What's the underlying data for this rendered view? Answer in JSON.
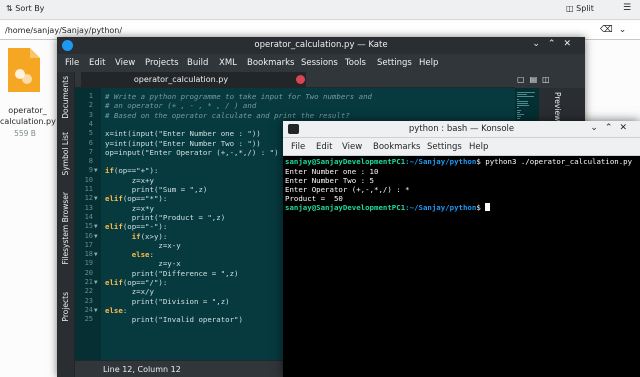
{
  "dolphin": {
    "sort_label": "Sort By",
    "split_label": "Split",
    "location": "/home/sanjay/Sanjay/python/",
    "file": {
      "name_line1": "operator_",
      "name_line2": "calculation.py",
      "size": "559 B",
      "icon": "python-file-icon"
    }
  },
  "kate": {
    "title": "operator_calculation.py — Kate",
    "menu": [
      "File",
      "Edit",
      "View",
      "Projects",
      "Build",
      "XML",
      "Bookmarks",
      "Sessions",
      "Tools",
      "Settings",
      "Help"
    ],
    "sidebar_tabs": [
      "Documents",
      "Symbol List",
      "Filesystem Browser",
      "Projects"
    ],
    "tab_label": "operator_calculation.py",
    "preview_label": "Preview",
    "status": "Line 12, Column 12",
    "code_lines": [
      {
        "n": "1",
        "parts": [
          [
            "c-comment",
            "# Write a python programme to take input for Two numbers and"
          ]
        ]
      },
      {
        "n": "2",
        "parts": [
          [
            "c-comment",
            "# an operator (+ , - , * , / ) and"
          ]
        ]
      },
      {
        "n": "3",
        "parts": [
          [
            "c-comment",
            "# Based on the operator calculate and print the result?"
          ]
        ]
      },
      {
        "n": "4",
        "parts": [
          [
            "c-plain",
            ""
          ]
        ]
      },
      {
        "n": "5",
        "parts": [
          [
            "c-plain",
            "x=int(input(\"Enter Number one : \"))"
          ]
        ]
      },
      {
        "n": "6",
        "parts": [
          [
            "c-plain",
            "y=int(input(\"Enter Number Two : \"))"
          ]
        ]
      },
      {
        "n": "7",
        "parts": [
          [
            "c-plain",
            "op=input(\"Enter Operator (+,-,*,/) : \")"
          ]
        ]
      },
      {
        "n": "8",
        "parts": [
          [
            "c-plain",
            ""
          ]
        ]
      },
      {
        "n": "9",
        "parts": [
          [
            "c-key",
            "if"
          ],
          [
            "c-plain",
            "(op==\"+\"):"
          ]
        ]
      },
      {
        "n": "10",
        "parts": [
          [
            "c-plain",
            "      z=x+y"
          ]
        ]
      },
      {
        "n": "11",
        "parts": [
          [
            "c-plain",
            "      print(\"Sum = \",z)"
          ]
        ]
      },
      {
        "n": "12",
        "parts": [
          [
            "c-key",
            "elif"
          ],
          [
            "c-plain",
            "(op==\"*\"):"
          ]
        ]
      },
      {
        "n": "13",
        "parts": [
          [
            "c-plain",
            "      z=x*y"
          ]
        ]
      },
      {
        "n": "14",
        "parts": [
          [
            "c-plain",
            "      print(\"Product = \",z)"
          ]
        ]
      },
      {
        "n": "15",
        "parts": [
          [
            "c-key",
            "elif"
          ],
          [
            "c-plain",
            "(op==\"-\"):"
          ]
        ]
      },
      {
        "n": "16",
        "parts": [
          [
            "c-key",
            "      if"
          ],
          [
            "c-plain",
            "(x>y):"
          ]
        ]
      },
      {
        "n": "17",
        "parts": [
          [
            "c-plain",
            "            z=x-y"
          ]
        ]
      },
      {
        "n": "18",
        "parts": [
          [
            "c-key",
            "      else"
          ],
          [
            "c-plain",
            ":"
          ]
        ]
      },
      {
        "n": "19",
        "parts": [
          [
            "c-plain",
            "            z=y-x"
          ]
        ]
      },
      {
        "n": "20",
        "parts": [
          [
            "c-plain",
            "      print(\"Difference = \",z)"
          ]
        ]
      },
      {
        "n": "21",
        "parts": [
          [
            "c-key",
            "elif"
          ],
          [
            "c-plain",
            "(op==\"/\"):"
          ]
        ]
      },
      {
        "n": "22",
        "parts": [
          [
            "c-plain",
            "      z=x/y"
          ]
        ]
      },
      {
        "n": "23",
        "parts": [
          [
            "c-plain",
            "      print(\"Division = \",z)"
          ]
        ]
      },
      {
        "n": "24",
        "parts": [
          [
            "c-key",
            "else"
          ],
          [
            "c-plain",
            ":"
          ]
        ]
      },
      {
        "n": "25",
        "parts": [
          [
            "c-plain",
            "      print(\"Invalid operator\")"
          ]
        ]
      }
    ]
  },
  "konsole": {
    "title": "python : bash — Konsole",
    "menu": [
      "File",
      "Edit",
      "View",
      "Bookmarks",
      "Settings",
      "Help"
    ],
    "prompt_user": "sanjay@SanjayDevelopmentPC1",
    "prompt_path": ":~/Sanjay/python",
    "command": "$ python3 ./operator_calculation.py",
    "output": [
      "Enter Number one : 10",
      "Enter Number Two : 5",
      "Enter Operator (+,-,*,/) : *",
      "Product =  50"
    ],
    "prompt_end": "$ "
  }
}
